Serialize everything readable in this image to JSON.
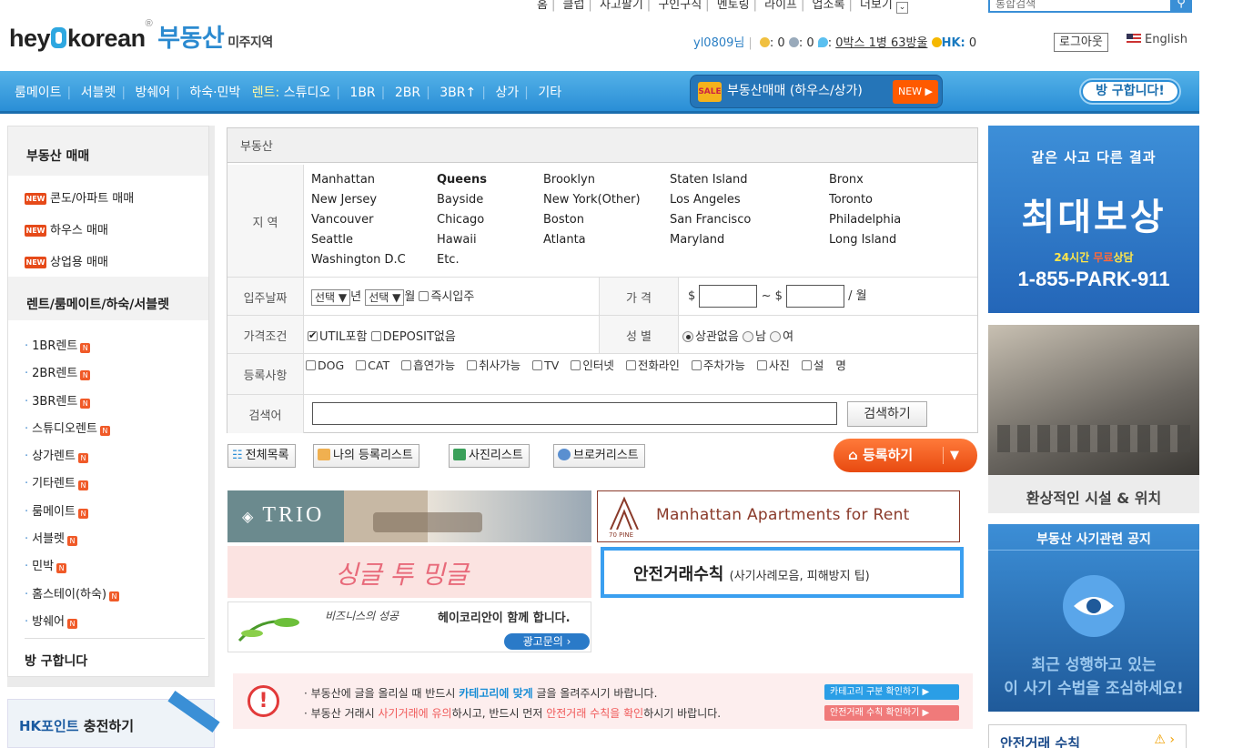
{
  "top_links": [
    "홈",
    "클럽",
    "사고팔기",
    "구인구직",
    "멘토링",
    "라이프",
    "업소록",
    "더보기"
  ],
  "global_search": {
    "placeholder": "통합검색"
  },
  "logo": {
    "brand_pre": "hey",
    "brand_post": "korean",
    "registered": "®",
    "section": "부동산",
    "region": "미주지역"
  },
  "user": {
    "id": "yl0809님",
    "stat1": "0",
    "stat2": "0",
    "stat3": "0박스 1병 63방울",
    "hk_label": "HK:",
    "hk_value": "0",
    "logout": "로그아웃",
    "english": "English"
  },
  "nav": {
    "items": [
      "룸메이트",
      "서블렛",
      "방쉐어",
      "하숙·민박"
    ],
    "rent_label": "렌트:",
    "rent_items": [
      "스튜디오",
      "1BR",
      "2BR",
      "3BR↑",
      "상가",
      "기타"
    ],
    "sale_icon": "SALE",
    "sale_button": "부동산매매 (하우스/상가)",
    "sale_new": "NEW ▶",
    "need_room": "방 구합니다!"
  },
  "sidebar": {
    "sale_title": "부동산 매매",
    "new_badge": "NEW",
    "sale_items": [
      "콘도/아파트 매매",
      "하우스 매매",
      "상업용 매매"
    ],
    "rent_title": "렌트/룸메이트/하숙/서블렛",
    "rent_items": [
      "1BR렌트",
      "2BR렌트",
      "3BR렌트",
      "스튜디오렌트",
      "상가렌트",
      "기타렌트",
      "룸메이트",
      "서블렛",
      "민박",
      "홈스테이(하숙)",
      "방쉐어"
    ],
    "n_badge": "N",
    "need_title": "방 구합니다",
    "hk_point_a": "HK포인트",
    "hk_point_b": " 충전하기"
  },
  "form": {
    "title": "부동산",
    "region_label": "지 역",
    "regions": [
      [
        "Manhattan",
        "Queens",
        "Brooklyn",
        "Staten Island",
        "Bronx"
      ],
      [
        "New Jersey",
        "Bayside",
        "New York(Other)",
        "Los Angeles",
        "Toronto"
      ],
      [
        "Vancouver",
        "Chicago",
        "Boston",
        "San Francisco",
        "Philadelphia"
      ],
      [
        "Seattle",
        "Hawaii",
        "Atlanta",
        "Maryland",
        "Long Island"
      ],
      [
        "Washington D.C",
        "Etc."
      ]
    ],
    "movein_label": "입주날짜",
    "select_text": "선택 ▼",
    "year_unit": "년",
    "month_unit": "월",
    "immediate": "즉시입주",
    "price_label": "가 격",
    "currency": "$",
    "range_sep": "~ $",
    "per_month": "/ 월",
    "condition_label": "가격조건",
    "util": "UTIL포함",
    "deposit": "DEPOSIT없음",
    "gender_label": "성 별",
    "gender_options": [
      "상관없음",
      "남",
      "여"
    ],
    "reg_label": "등록사항",
    "reg_options": [
      "DOG",
      "CAT",
      "흡연가능",
      "취사가능",
      "TV",
      "인터넷",
      "전화라인",
      "주차가능",
      "사진",
      "설"
    ],
    "reg_wrap": "명",
    "keyword_label": "검색어",
    "search_button": "검색하기"
  },
  "toolbar": {
    "all": "전체목록",
    "mine": "나의 등록리스트",
    "photo": "사진리스트",
    "broker": "브로커리스트",
    "register": "등록하기",
    "register_arrow": "▼"
  },
  "banners": {
    "trio": "TRIO",
    "mha": "Manhattan Apartments for Rent",
    "mha_sub": "70 PINE",
    "single": "싱글 투 밍글",
    "safe": "안전거래수칙",
    "safe_sub": "(사기사례모음, 피해방지 팁)",
    "biz_a": "비즈니스의 성공",
    "biz_b": "헤이코리안이 함께 합니다.",
    "ad": "광고문의 ›"
  },
  "notice": {
    "mark": "!",
    "l1_a": "· 부동산에 글을 올리실 때 반드시 ",
    "l1_b": "카테고리에 맞게",
    "l1_c": " 글을 올려주시기 바랍니다.",
    "l2_a": "· 부동산 거래시 ",
    "l2_b": "사기거래에 유의",
    "l2_c": "하시고, 반드시 먼저 ",
    "l2_d": "안전거래 수칙을 확인",
    "l2_e": "하시기 바랍니다.",
    "btn1": "카테고리 구분 확인하기 ▶",
    "btn2": "안전거래 수칙 확인하기 ▶"
  },
  "right": {
    "ad1_a": "같은 사고 다른 결과",
    "ad1_b": "최대보상",
    "ad1_c1": "24시간 ",
    "ad1_c2": "무료",
    "ad1_c3": "상담",
    "ad1_phone": "1-855-PARK-911",
    "gym_caption": "환상적인 시설 & 위치",
    "scam_title": "부동산 사기관련 공지",
    "scam_l1": "최근 성행하고 있는",
    "scam_l2": "이 사기 수법을 조심하세요!",
    "safe_title": "안전거래 수칙"
  },
  "colors": {
    "accent": "#2a8ed6",
    "orange": "#e84a10",
    "new": "#e64a19"
  }
}
